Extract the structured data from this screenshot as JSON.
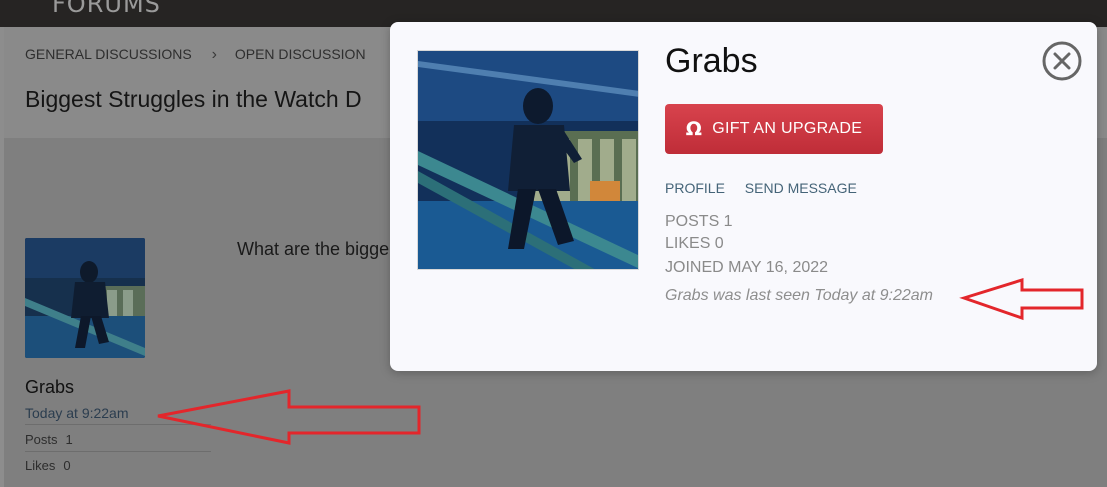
{
  "site": {
    "title": "FORUMS"
  },
  "breadcrumb": [
    "GENERAL DISCUSSIONS",
    "OPEN DISCUSSION"
  ],
  "thread": {
    "title": "Biggest Struggles in the Watch D"
  },
  "post": {
    "username": "Grabs",
    "time": "Today at 9:22am",
    "posts_label": "Posts",
    "posts_value": "1",
    "likes_label": "Likes",
    "likes_value": "0",
    "body_excerpt": "What are the bigge"
  },
  "profile_card": {
    "name": "Grabs",
    "gift_button": {
      "icon": "Ω",
      "label": "GIFT AN UPGRADE"
    },
    "links": [
      "PROFILE",
      "SEND MESSAGE"
    ],
    "posts": "POSTS 1",
    "likes": "LIKES 0",
    "joined": "JOINED MAY 16, 2022",
    "last_seen": "Grabs was last seen Today at 9:22am",
    "close_icon": "close-circle-icon"
  },
  "colors": {
    "accent_red": "#d03a44",
    "link": "#456478",
    "arrow": "#e3262b"
  }
}
